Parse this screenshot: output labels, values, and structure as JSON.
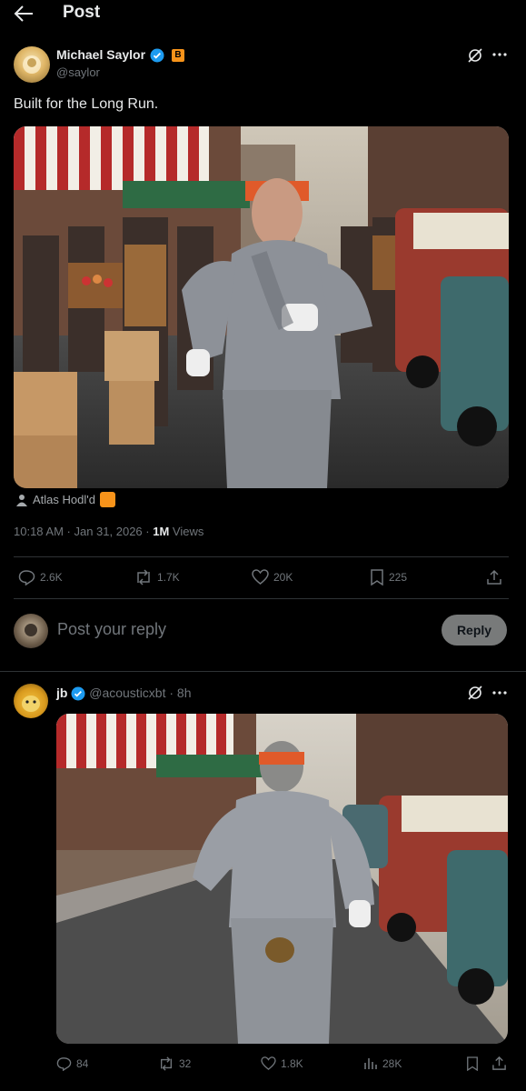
{
  "header": {
    "title": "Post"
  },
  "post": {
    "author_name": "Michael Saylor",
    "author_handle": "@saylor",
    "badge": "B",
    "text": "Built for the Long Run.",
    "image_alt": "Photo: man in gray sweatsuit and orange headband running through a street market",
    "credit": "Atlas Hodl'd",
    "time": "10:18 AM · Jan 31, 2026 · ",
    "views_count": "1M",
    "views_label": " Views",
    "replies": "2.6K",
    "reposts": "1.7K",
    "likes": "20K",
    "bookmarks": "225"
  },
  "reply_box": {
    "placeholder": "Post your reply",
    "button": "Reply"
  },
  "reply": {
    "author_name": "jb",
    "author_handle": "@acousticxbt",
    "age": "· 8h",
    "replies": "84",
    "reposts": "32",
    "likes": "1.8K",
    "views": "28K"
  },
  "colors": {
    "verified": "#1d9bf0",
    "btc": "#f7931a",
    "background": "#000000"
  }
}
